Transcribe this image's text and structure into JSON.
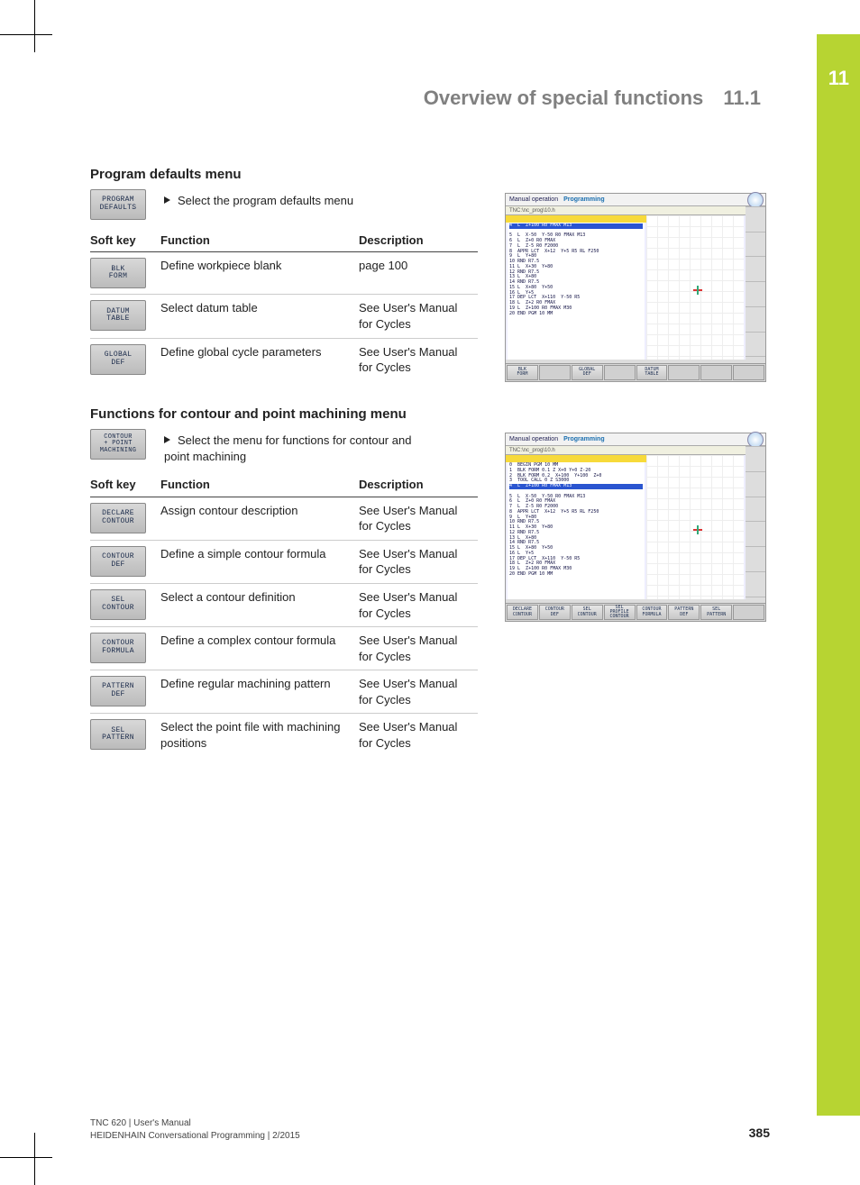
{
  "chapter": "11",
  "running_head_title": "Overview of special functions",
  "running_head_num": "11.1",
  "section1": {
    "heading": "Program defaults menu",
    "intro_key": "PROGRAM\nDEFAULTS",
    "intro_text": "Select the program defaults menu",
    "th_soft": "Soft key",
    "th_func": "Function",
    "th_desc": "Description",
    "rows": [
      {
        "key": "BLK\nFORM",
        "func": "Define workpiece blank",
        "desc": "page 100"
      },
      {
        "key": "DATUM\nTABLE",
        "func": "Select datum table",
        "desc": "See User's Manual for Cycles"
      },
      {
        "key": "GLOBAL\nDEF",
        "func": "Define global cycle parameters",
        "desc": "See User's Manual for Cycles"
      }
    ],
    "screenshot": {
      "mode_manual": "Manual operation",
      "mode_prog": "Programming",
      "path": "TNC:\\nc_prog\\10.h",
      "buttons": [
        "BLK\nFORM",
        "",
        "GLOBAL\nDEF",
        "",
        "DATUM\nTABLE",
        "",
        "",
        ""
      ]
    }
  },
  "section2": {
    "heading": "Functions for contour and point machining menu",
    "intro_key": "CONTOUR\n+ POINT\nMACHINING",
    "intro_text": "Select the menu for functions for contour and point machining",
    "th_soft": "Soft key",
    "th_func": "Function",
    "th_desc": "Description",
    "rows": [
      {
        "key": "DECLARE\nCONTOUR",
        "func": "Assign contour description",
        "desc": "See User's Manual for Cycles"
      },
      {
        "key": "CONTOUR\nDEF",
        "func": "Define a simple contour formula",
        "desc": "See User's Manual for Cycles"
      },
      {
        "key": "SEL\nCONTOUR",
        "func": "Select a contour definition",
        "desc": "See User's Manual for Cycles"
      },
      {
        "key": "CONTOUR\nFORMULA",
        "func": "Define a complex contour formula",
        "desc": "See User's Manual for Cycles"
      },
      {
        "key": "PATTERN\nDEF",
        "func": "Define regular machining pattern",
        "desc": "See User's Manual for Cycles"
      },
      {
        "key": "SEL\nPATTERN",
        "func": "Select the point file with machining positions",
        "desc": "See User's Manual for Cycles"
      }
    ],
    "screenshot": {
      "mode_manual": "Manual operation",
      "mode_prog": "Programming",
      "path": "TNC:\\nc_prog\\10.h",
      "buttons": [
        "DECLARE\nCONTOUR",
        "CONTOUR\nDEF",
        "SEL\nCONTOUR",
        "SEL\nPROFILE\nCONTOUR",
        "CONTOUR\nFORMULA",
        "PATTERN\nDEF",
        "SEL\nPATTERN",
        ""
      ]
    }
  },
  "codesample": "0  BEGIN PGM 10 MM\n1  BLK FORM 0.1 Z X+0 Y+0 Z-20\n2  BLK FORM 0.2  X+100  Y+100  Z+0\n3  TOOL CALL 0 Z S3000\n5  L  X-50  Y-50 R0 FMAX M13\n6  L  Z+0 R0 FMAX\n7  L  Z-5 R0 F2000\n8  APPR LCT  X+12  Y+5 R5 RL F250\n9  L  Y+80\n10 RND R7.5\n11 L  X+30  Y+80\n12 RND R7.5\n13 L  X+80\n14 RND R7.5\n15 L  X+80  Y+50\n16 L  Y+5\n17 DEP LCT  X+110  Y-50 R5\n18 L  Z+2 R0 FMAX\n19 L  Z+100 R0 FMAX M30\n20 END PGM 10 MM",
  "footer": {
    "line1": "TNC 620 | User's Manual",
    "line2": "HEIDENHAIN Conversational Programming | 2/2015",
    "page": "385"
  }
}
